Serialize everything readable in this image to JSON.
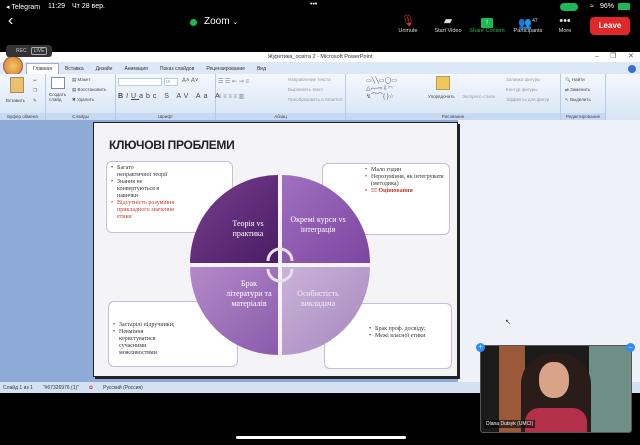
{
  "status_bar": {
    "back_app": "◂ Telegram",
    "time": "11:29",
    "date": "Чт 28 вер.",
    "battery": "96%"
  },
  "zoom_bar": {
    "title": "Zoom",
    "buttons": [
      {
        "label": "Unmute",
        "icon": "mic-muted-icon"
      },
      {
        "label": "Start Video",
        "icon": "video-off-icon"
      },
      {
        "label": "Share Content",
        "icon": "share-icon"
      },
      {
        "label": "Participants",
        "icon": "participants-icon",
        "count": "47"
      },
      {
        "label": "More",
        "icon": "more-icon"
      }
    ],
    "leave": "Leave",
    "accent": "#1db954",
    "leave_color": "#e02828"
  },
  "rec": {
    "rec": "REC",
    "live": "LIVE"
  },
  "ppt": {
    "window_title": "Журетика_освіта 2 - Microsoft PowerPoint",
    "tabs": [
      "Главная",
      "Вставка",
      "Дизайн",
      "Анимация",
      "Показ слайдов",
      "Рецензирование",
      "Вид"
    ],
    "ribbon": {
      "paste": "Вставить",
      "new_slide": "Создать слайд",
      "layout": "Макет",
      "reset": "Восстановить",
      "delete": "Удалить",
      "font_size": "18",
      "dir": "Направление текста",
      "align": "Выровнять текст",
      "smartart": "Преобразовать в SmartArt",
      "arrange": "Упорядочить",
      "quick_styles": "Экспресс-стили",
      "fill": "Заливка фигуры",
      "outline": "Контур фигуры",
      "effects": "Эффекты для фигур",
      "find": "Найти",
      "replace": "Заменить",
      "select": "Выделить",
      "groups": [
        "Буфер обмена",
        "Слайды",
        "Шрифт",
        "Абзац",
        "Рисование",
        "Редактирование"
      ]
    },
    "slide": {
      "title": "КЛЮЧОВІ ПРОБЛЕМИ",
      "quadrants": [
        "Теорія vs практика",
        "Окремі курси vs інтеграція",
        "Брак літератури та матеріалів",
        "Особистість викладача"
      ],
      "boxes": {
        "tl": [
          "Багато непрактичної теорії",
          "Знання не конвертуються в навички",
          "Відсутність розуміння прикладного значення етики"
        ],
        "tr": [
          "Мало годин",
          "Нерозуміння, як інтегрувати (методика)",
          "!!! Оцінювання"
        ],
        "bl": [
          "Застарілі підручники;",
          "Невміння користуватися сучасними можливостями"
        ],
        "br": [
          "Брак проф. досвіду;",
          "Межі власної етики"
        ]
      }
    },
    "statusbar": {
      "slide": "Слайд 1 из 1",
      "theme": "\"#67326976 (1)\"",
      "lang": "Русский (Россия)"
    }
  },
  "video": {
    "name": "Diana Dutsyk (UMCI)"
  }
}
